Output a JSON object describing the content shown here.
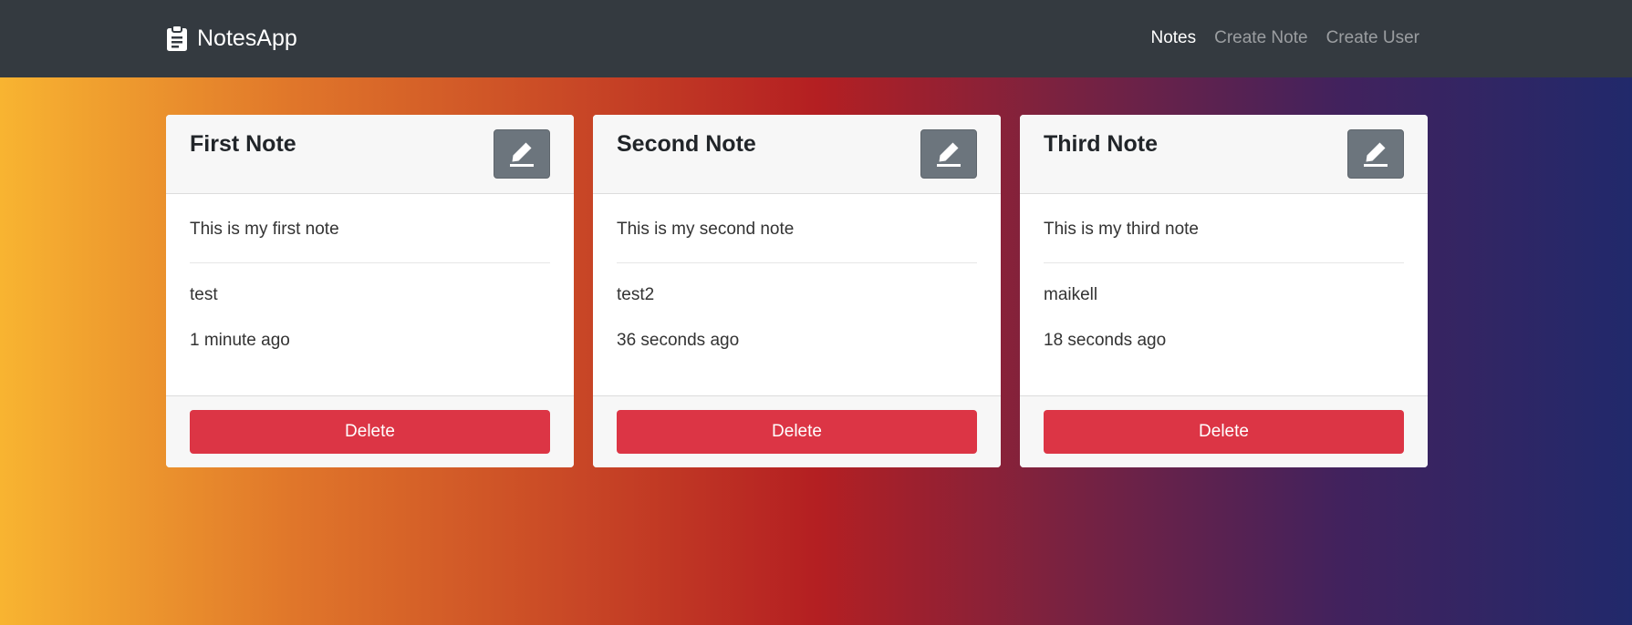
{
  "navbar": {
    "brand": "NotesApp",
    "brand_icon": "clipboard-icon",
    "links": [
      {
        "label": "Notes",
        "active": true
      },
      {
        "label": "Create Note",
        "active": false
      },
      {
        "label": "Create User",
        "active": false
      }
    ]
  },
  "notes": [
    {
      "title": "First Note",
      "content": "This is my first note",
      "author": "test",
      "time": "1 minute ago",
      "delete_label": "Delete"
    },
    {
      "title": "Second Note",
      "content": "This is my second note",
      "author": "test2",
      "time": "36 seconds ago",
      "delete_label": "Delete"
    },
    {
      "title": "Third Note",
      "content": "This is my third note",
      "author": "maikell",
      "time": "18 seconds ago",
      "delete_label": "Delete"
    }
  ],
  "colors": {
    "navbar": "#343a40",
    "edit_button": "#6c757d",
    "delete_button": "#dc3545",
    "gradient": [
      "#f8b431",
      "#b41f22",
      "#21296b"
    ]
  }
}
